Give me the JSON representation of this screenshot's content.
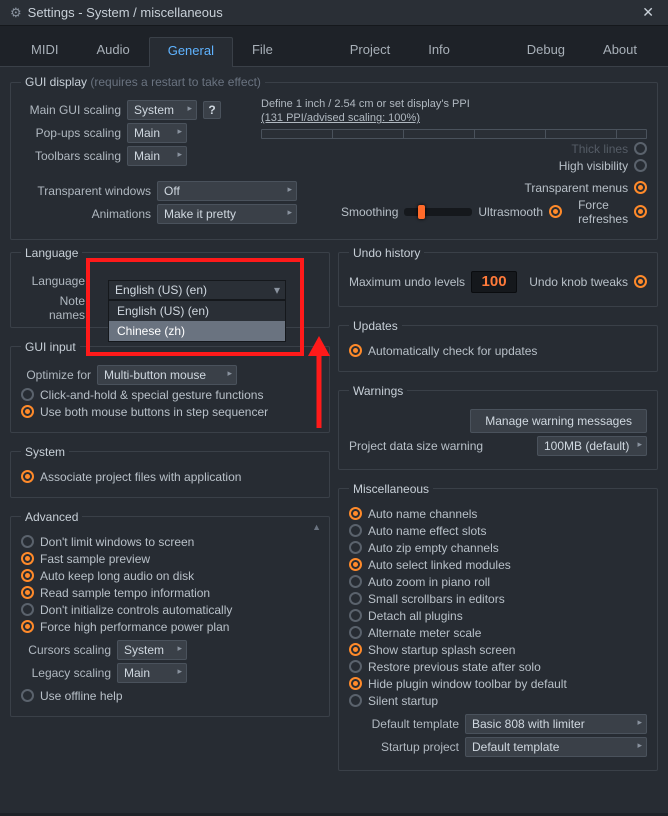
{
  "window": {
    "title": "Settings - System / miscellaneous"
  },
  "tabs": [
    "MIDI",
    "Audio",
    "General",
    "File",
    "Project",
    "Info",
    "Debug",
    "About"
  ],
  "active_tab": "General",
  "gui_display": {
    "legend": "GUI display",
    "legend_hint": "(requires a restart to take effect)",
    "main_scaling_label": "Main GUI scaling",
    "main_scaling_value": "System",
    "popups_label": "Pop-ups scaling",
    "popups_value": "Main",
    "toolbars_label": "Toolbars scaling",
    "toolbars_value": "Main",
    "ppi_line1": "Define 1 inch / 2.54 cm or set display's PPI",
    "ppi_line2": "(131 PPI/advised scaling: 100%)",
    "transparent_windows_label": "Transparent windows",
    "transparent_windows_value": "Off",
    "animations_label": "Animations",
    "animations_value": "Make it pretty",
    "smoothing_label": "Smoothing",
    "opts": {
      "thick_lines": "Thick lines",
      "high_vis": "High visibility",
      "transp_menus": "Transparent menus",
      "ultrasmooth": "Ultrasmooth",
      "force_refreshes": "Force refreshes"
    }
  },
  "language": {
    "legend": "Language",
    "language_label": "Language",
    "language_value": "English (US) (en)",
    "note_names_label": "Note names",
    "options": [
      "English (US) (en)",
      "Chinese (zh)"
    ]
  },
  "gui_input": {
    "legend": "GUI input",
    "optimize_label": "Optimize for",
    "optimize_value": "Multi-button mouse",
    "click_hold": "Click-and-hold & special gesture functions",
    "both_buttons": "Use both mouse buttons in step sequencer"
  },
  "system": {
    "legend": "System",
    "assoc": "Associate project files with application"
  },
  "advanced": {
    "legend": "Advanced",
    "items": [
      {
        "label": "Don't limit windows to screen",
        "on": false
      },
      {
        "label": "Fast sample preview",
        "on": true
      },
      {
        "label": "Auto keep long audio on disk",
        "on": true
      },
      {
        "label": "Read sample tempo information",
        "on": true
      },
      {
        "label": "Don't initialize controls automatically",
        "on": false
      },
      {
        "label": "Force high performance power plan",
        "on": true
      }
    ],
    "cursors_label": "Cursors scaling",
    "cursors_value": "System",
    "legacy_label": "Legacy scaling",
    "legacy_value": "Main",
    "offline_help": "Use offline help"
  },
  "undo": {
    "legend": "Undo history",
    "max_label": "Maximum undo levels",
    "max_value": "100",
    "knob_tweaks": "Undo knob tweaks"
  },
  "updates": {
    "legend": "Updates",
    "auto_check": "Automatically check for updates"
  },
  "warnings": {
    "legend": "Warnings",
    "manage_btn": "Manage warning messages",
    "size_label": "Project data size warning",
    "size_value": "100MB (default)"
  },
  "misc": {
    "legend": "Miscellaneous",
    "items": [
      {
        "label": "Auto name channels",
        "on": true
      },
      {
        "label": "Auto name effect slots",
        "on": false
      },
      {
        "label": "Auto zip empty channels",
        "on": false
      },
      {
        "label": "Auto select linked modules",
        "on": true
      },
      {
        "label": "Auto zoom in piano roll",
        "on": false
      },
      {
        "label": "Small scrollbars in editors",
        "on": false
      },
      {
        "label": "Detach all plugins",
        "on": false
      },
      {
        "label": "Alternate meter scale",
        "on": false
      },
      {
        "label": "Show startup splash screen",
        "on": true
      },
      {
        "label": "Restore previous state after solo",
        "on": false
      },
      {
        "label": "Hide plugin window toolbar by default",
        "on": true
      },
      {
        "label": "Silent startup",
        "on": false
      }
    ],
    "default_template_label": "Default template",
    "default_template_value": "Basic 808 with limiter",
    "startup_project_label": "Startup project",
    "startup_project_value": "Default template"
  }
}
